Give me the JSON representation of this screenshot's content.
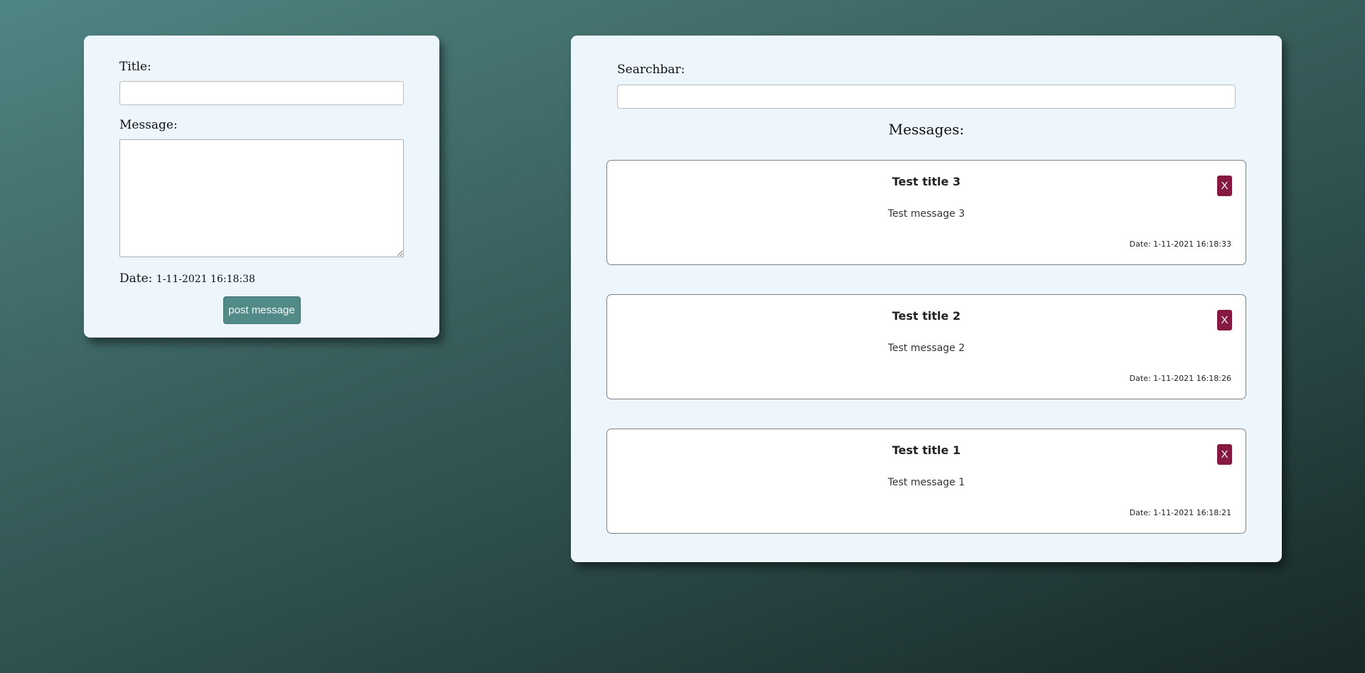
{
  "compose": {
    "title_label": "Title:",
    "title_value": "",
    "message_label": "Message:",
    "message_value": "",
    "date_label": "Date:",
    "date_value": "1-11-2021 16:18:38",
    "post_button": "post message"
  },
  "list": {
    "search_label": "Searchbar:",
    "search_value": "",
    "heading": "Messages:",
    "delete_label": "X",
    "messages": [
      {
        "title": "Test title 3",
        "body": "Test message 3",
        "date": "Date: 1-11-2021 16:18:33"
      },
      {
        "title": "Test title 2",
        "body": "Test message 2",
        "date": "Date: 1-11-2021 16:18:26"
      },
      {
        "title": "Test title 1",
        "body": "Test message 1",
        "date": "Date: 1-11-2021 16:18:21"
      }
    ]
  },
  "colors": {
    "panel_background": "#eef6fd",
    "post_button": "#528a87",
    "delete_button": "#85193f"
  }
}
